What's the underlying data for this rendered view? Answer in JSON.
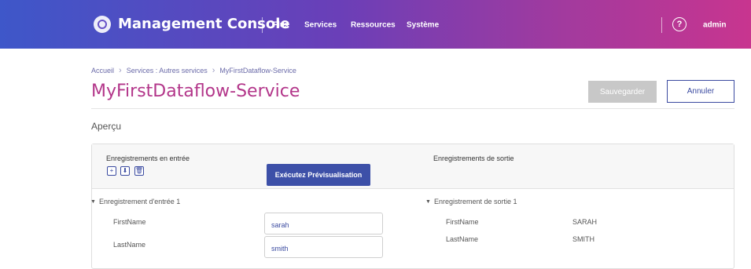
{
  "header": {
    "app_title": "Management Console",
    "nav": [
      "Flux",
      "Services",
      "Ressources",
      "Système"
    ],
    "help": "?",
    "user": "admin"
  },
  "breadcrumb": [
    "Accueil",
    "Services : Autres services",
    "MyFirstDataflow-Service"
  ],
  "page": {
    "title": "MyFirstDataflow-Service",
    "save_label": "Sauvegarder",
    "cancel_label": "Annuler"
  },
  "section": {
    "title": "Aperçu"
  },
  "preview": {
    "input_label": "Enregistrements en entrée",
    "output_label": "Enregistrements de sortie",
    "run_label": "Exécutez Prévisualisation",
    "tools": [
      "+",
      "⬇",
      "🗑"
    ],
    "input_record": {
      "title": "Enregistrement d'entrée 1",
      "fields": [
        {
          "label": "FirstName",
          "value": "sarah"
        },
        {
          "label": "LastName",
          "value": "smith"
        }
      ]
    },
    "output_record": {
      "title": "Enregistrement de sortie 1",
      "fields": [
        {
          "label": "FirstName",
          "value": "SARAH"
        },
        {
          "label": "LastName",
          "value": "SMITH"
        }
      ]
    }
  }
}
